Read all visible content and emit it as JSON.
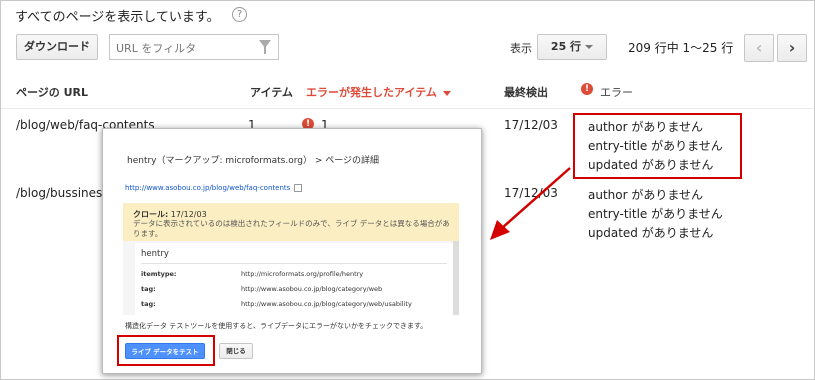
{
  "page": {
    "heading": "すべてのページを表示しています。",
    "help_icon": "?"
  },
  "toolbar": {
    "download_label": "ダウンロード",
    "filter_placeholder": "URL をフィルタ",
    "filter_icon": "filter-icon",
    "show_label": "表示",
    "rows_value": "25 行",
    "pager_text": "209 行中 1〜25 行",
    "prev_glyph": "‹",
    "next_glyph": "›"
  },
  "table": {
    "headers": {
      "url": "ページの URL",
      "items": "アイテム",
      "error_items": "エラーが発生したアイテム",
      "last_detected": "最終検出",
      "errors": "エラー"
    },
    "rows": [
      {
        "url": "/blog/web/faq-contents",
        "items": "1",
        "error_items": "1",
        "last_detected": "17/12/03",
        "errors": [
          "author がありません",
          "entry-title がありません",
          "updated がありません"
        ]
      },
      {
        "url": "/blog/bussines",
        "items": "",
        "error_items": "",
        "last_detected": "17/12/03",
        "errors": [
          "author がありません",
          "entry-title がありません",
          "updated がありません"
        ]
      }
    ]
  },
  "popup": {
    "title": "hentry（マークアップ: microformats.org） > ページの詳細",
    "link": "http://www.asobou.co.jp/blog/web/faq-contents",
    "crawl_label": "クロール:",
    "crawl_date": "17/12/03",
    "crawl_note": "データに表示されているのは検出されたフィールドのみで、ライブ データとは異なる場合があります。",
    "detail_title": "hentry",
    "fields": [
      {
        "key": "itemtype:",
        "value": "http://microformats.org/profile/hentry"
      },
      {
        "key": "tag:",
        "value": "http://www.asobou.co.jp/blog/category/web"
      },
      {
        "key": "tag:",
        "value": "http://www.asobou.co.jp/blog/category/web/usability"
      }
    ],
    "note": "構造化データ テストツールを使用すると、ライブデータにエラーがないかをチェックできます。",
    "test_button": "ライブ データをテスト",
    "close_button": "閉じる"
  },
  "colors": {
    "error_red": "#dd4b39",
    "highlight_red": "#d40000",
    "primary_blue": "#4d90fe",
    "crawl_bg": "#fbeec2"
  }
}
